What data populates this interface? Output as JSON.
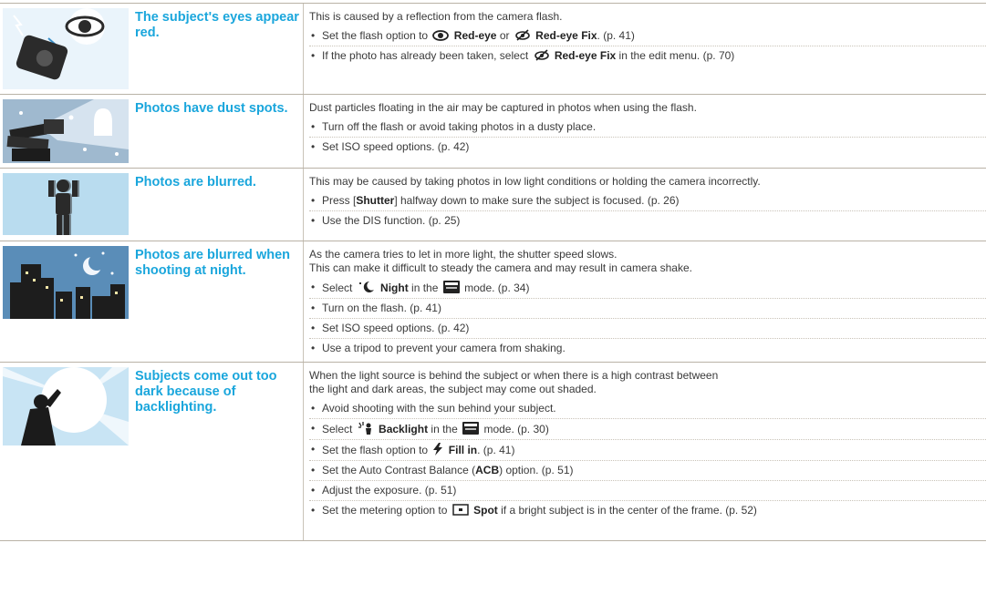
{
  "rows": [
    {
      "title": "The subject's eyes appear red.",
      "intro": "This is caused by a reflection from the camera flash.",
      "items": [
        {
          "pre": "Set the flash option to",
          "b1": "Red-eye",
          "mid": "or",
          "b2": "Red-eye Fix",
          "post": ". (p. 41)"
        },
        {
          "pre": "If the photo has already been taken, select",
          "b1": "Red-eye Fix",
          "post": "in the edit menu. (p. 70)"
        }
      ]
    },
    {
      "title": "Photos have dust spots.",
      "intro": "Dust particles floating in the air may be captured in photos when using the flash.",
      "items": [
        {
          "text": "Turn off the flash or avoid taking photos in a dusty place."
        },
        {
          "text": "Set ISO speed options. (p. 42)"
        }
      ]
    },
    {
      "title": "Photos are blurred.",
      "intro": "This may be caused by taking photos in low light conditions or holding the camera incorrectly.",
      "items": [
        {
          "pre": "Press [",
          "b1": "Shutter",
          "post": "] halfway down to make sure the subject is focused. (p. 26)"
        },
        {
          "text": "Use the DIS function. (p. 25)"
        }
      ]
    },
    {
      "title": "Photos are blurred when shooting at night.",
      "intro": "As the camera tries to let in more light, the shutter speed slows.",
      "intro2": "This can make it difficult to steady the camera and may result in camera shake.",
      "items": [
        {
          "pre": "Select",
          "b1": "Night",
          "mid": "in the",
          "post": "mode. (p. 34)"
        },
        {
          "text": "Turn on the flash. (p. 41)"
        },
        {
          "text": "Set ISO speed options. (p. 42)"
        },
        {
          "text": "Use a tripod to prevent your camera from shaking."
        }
      ]
    },
    {
      "title": "Subjects come out too dark because of backlighting.",
      "intro": "When the light source is behind the subject or when there is a high contrast between",
      "intro2": "the light and dark areas, the subject may come out shaded.",
      "items": [
        {
          "text": "Avoid shooting with the sun behind your subject."
        },
        {
          "pre": "Select",
          "b1": "Backlight",
          "mid": "in the",
          "post": "mode. (p. 30)"
        },
        {
          "pre": "Set the flash option to",
          "b1": "Fill in",
          "post": ". (p. 41)"
        },
        {
          "pre": "Set the Auto Contrast Balance (",
          "b1": "ACB",
          "post": ") option. (p. 51)"
        },
        {
          "text": "Adjust the exposure. (p. 51)"
        },
        {
          "pre": "Set the metering option to",
          "b1": "Spot",
          "post": "if a bright subject is in the center of the frame. (p. 52)"
        }
      ]
    }
  ],
  "icons": {
    "red_eye": "eye-icon",
    "red_eye_fix": "red-eye-fix-icon",
    "night": "night-scene-icon",
    "scene": "scene-mode-icon",
    "backlight": "backlight-icon",
    "flash": "flash-icon",
    "spot": "spot-metering-icon"
  },
  "colors": {
    "title": "#1aa6dc",
    "rule": "#b9b2a6"
  }
}
